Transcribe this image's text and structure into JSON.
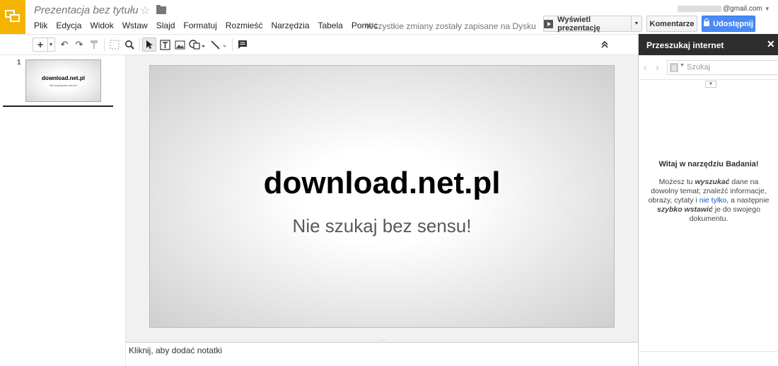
{
  "app": {
    "doc_title": "Prezentacja bez tytułu",
    "save_status": "Wszystkie zmiany zostały zapisane na Dysku",
    "account": "@gmail.com"
  },
  "menu": [
    "Plik",
    "Edycja",
    "Widok",
    "Wstaw",
    "Slajd",
    "Formatuj",
    "Rozmieść",
    "Narzędzia",
    "Tabela",
    "Pomoc"
  ],
  "buttons": {
    "present": "Wyświetl prezentację",
    "comments": "Komentarze",
    "share": "Udostępnij"
  },
  "icons": {
    "star": "☆",
    "undo": "↶",
    "redo": "↷",
    "zoom": "⚲",
    "collapse": "⌃",
    "close": "✕",
    "back": "‹",
    "forward": "›"
  },
  "filmstrip": {
    "slide_number": "1",
    "thumb_title": "download.net.pl",
    "thumb_subtitle": "Nie szukaj bez sensu!"
  },
  "slide": {
    "title": "download.net.pl",
    "subtitle": "Nie szukaj bez sensu!"
  },
  "notes": {
    "placeholder": "Kliknij, aby dodać notatki"
  },
  "research": {
    "title": "Przeszukaj internet",
    "search_placeholder": "Szukaj",
    "welcome_title": "Witaj w narzędziu Badania!",
    "body_1": "Możesz tu ",
    "body_em1": "wyszukać",
    "body_2": " dane na dowolny temat; znaleźć informacje, obrazy, cytaty i ",
    "body_link": "nie tylko",
    "body_3": ", a następnie ",
    "body_em2": "szybko wstawić",
    "body_4": " je do swojego dokumentu."
  },
  "colors": {
    "logo": "#f4b400",
    "share": "#4a8af4",
    "research_header": "#2d2d2d",
    "link": "#15c"
  }
}
